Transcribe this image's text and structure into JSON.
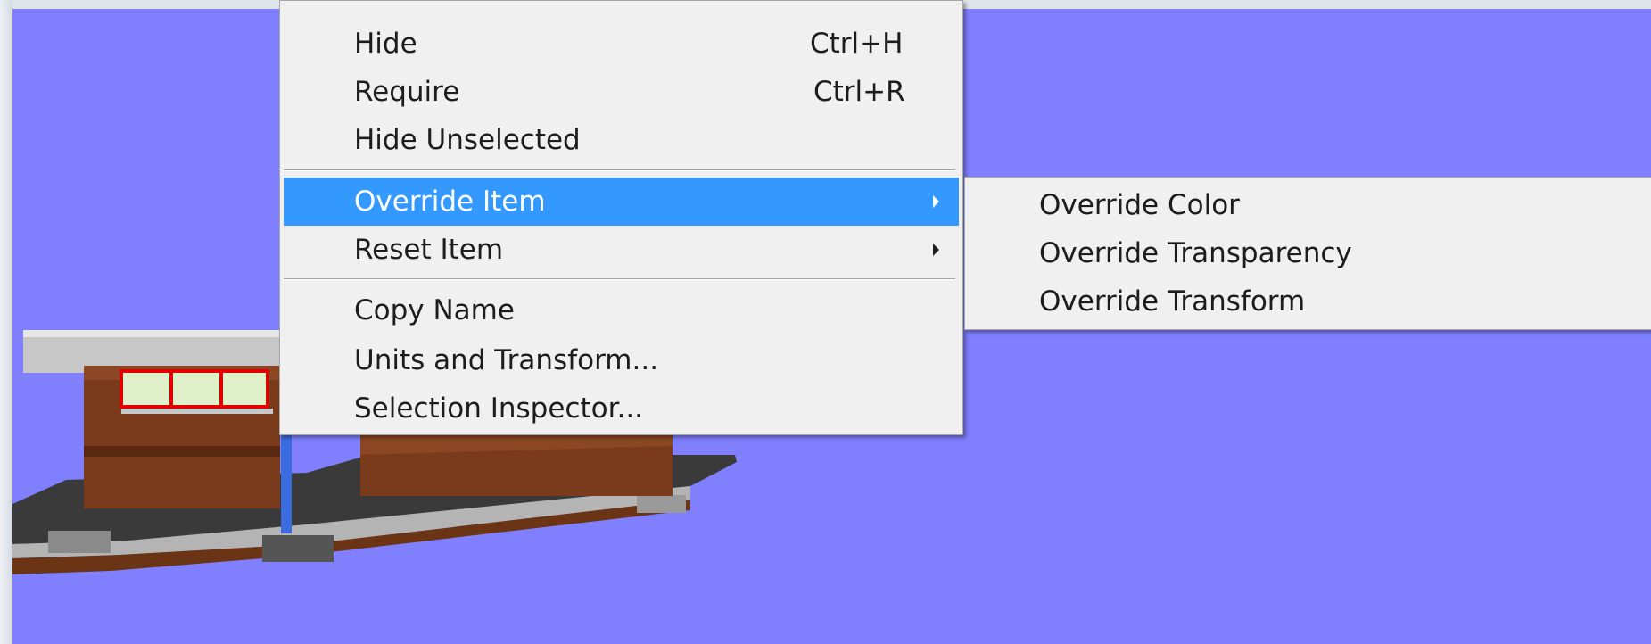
{
  "context_menu": {
    "items": [
      {
        "label": "Hide",
        "shortcut": "Ctrl+H"
      },
      {
        "label": "Require",
        "shortcut": "Ctrl+R"
      },
      {
        "label": "Hide Unselected"
      },
      {
        "label": "Override Item",
        "has_submenu": true,
        "highlighted": true
      },
      {
        "label": "Reset Item",
        "has_submenu": true
      },
      {
        "label": "Copy Name"
      },
      {
        "label": "Units and Transform..."
      },
      {
        "label": "Selection Inspector..."
      }
    ]
  },
  "submenu": {
    "items": [
      {
        "label": "Override Color"
      },
      {
        "label": "Override Transparency"
      },
      {
        "label": "Override Transform"
      }
    ]
  },
  "colors": {
    "viewport_background": "#8080ff",
    "menu_background": "#f0f0f0",
    "highlight": "#3399ff"
  }
}
